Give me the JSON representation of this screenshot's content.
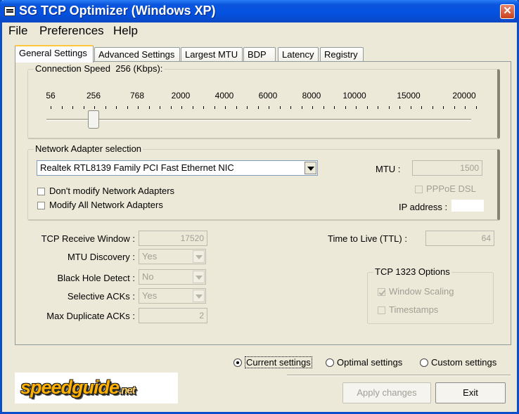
{
  "window": {
    "title": "SG TCP Optimizer (Windows XP)"
  },
  "menu": [
    "File",
    "Preferences",
    "Help"
  ],
  "tabs": [
    "General Settings",
    "Advanced Settings",
    "Largest MTU",
    "BDP",
    "Latency",
    "Registry"
  ],
  "active_tab": "General Settings",
  "connection_speed": {
    "label": "Connection Speed",
    "value": "256 (Kbps):",
    "ticks": [
      "56",
      "256",
      "768",
      "2000",
      "4000",
      "6000",
      "8000",
      "10000",
      "15000",
      "20000"
    ],
    "selected": "256"
  },
  "adapter": {
    "group_label": "Network Adapter selection",
    "selected": "Realtek RTL8139 Family PCI Fast Ethernet NIC",
    "dont_modify": "Don't modify Network Adapters",
    "modify_all": "Modify All Network Adapters",
    "mtu_label": "MTU :",
    "mtu_value": "1500",
    "pppoe_label": "PPPoE DSL",
    "ip_label": "IP address :",
    "ip_value": ""
  },
  "tcp": {
    "receive_window_label": "TCP Receive Window :",
    "receive_window_value": "17520",
    "mtu_discovery_label": "MTU Discovery :",
    "mtu_discovery_value": "Yes",
    "black_hole_label": "Black Hole Detect :",
    "black_hole_value": "No",
    "selective_acks_label": "Selective ACKs :",
    "selective_acks_value": "Yes",
    "max_dup_acks_label": "Max Duplicate ACKs :",
    "max_dup_acks_value": "2",
    "ttl_label": "Time to Live (TTL) :",
    "ttl_value": "64"
  },
  "tcp1323": {
    "group_label": "TCP 1323 Options",
    "window_scaling": "Window Scaling",
    "window_scaling_checked": true,
    "timestamps": "Timestamps",
    "timestamps_checked": false
  },
  "settings_mode": {
    "current": "Current settings",
    "optimal": "Optimal settings",
    "custom": "Custom settings",
    "selected": "current"
  },
  "buttons": {
    "apply": "Apply changes",
    "exit": "Exit"
  },
  "logo": {
    "main": "speedguide",
    "suffix": ".net"
  }
}
